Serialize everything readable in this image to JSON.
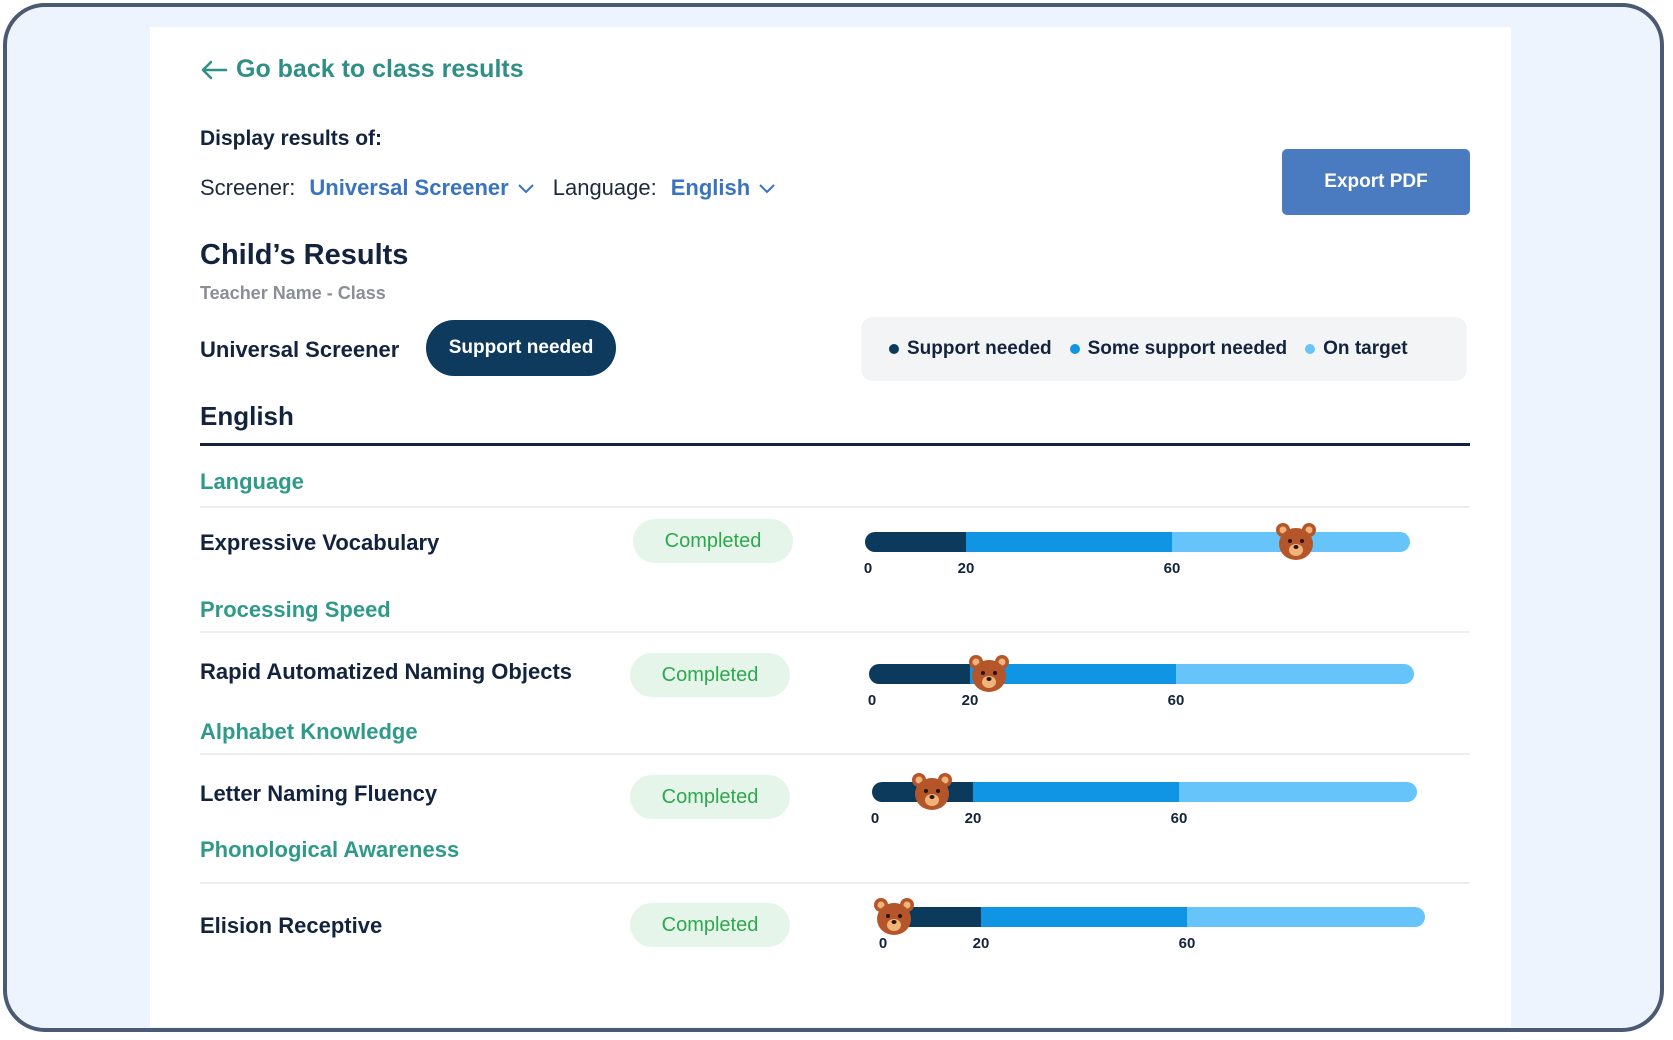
{
  "nav": {
    "back_label": "Go back to class results"
  },
  "filters": {
    "heading": "Display results of:",
    "screener_label": "Screener:",
    "screener_value": "Universal Screener",
    "language_label": "Language:",
    "language_value": "English"
  },
  "export_label": "Export PDF",
  "results": {
    "title": "Child’s Results",
    "subtitle": "Teacher Name - Class",
    "screener_name": "Universal Screener",
    "overall_status": "Support needed"
  },
  "legend": [
    {
      "label": "Support needed",
      "color": "#0b3a5c"
    },
    {
      "label": "Some support needed",
      "color": "#0f95e4"
    },
    {
      "label": "On target",
      "color": "#66c4fb"
    }
  ],
  "section_title": "English",
  "scale_ticks": [
    "0",
    "20",
    "60"
  ],
  "categories": [
    {
      "name": "Language",
      "test": "Expressive Vocabulary",
      "status": "Completed",
      "score_fraction": 0.79
    },
    {
      "name": "Processing Speed",
      "test": "Rapid Automatized Naming Objects",
      "status": "Completed",
      "score_fraction": 0.22
    },
    {
      "name": "Alphabet Knowledge",
      "test": "Letter Naming Fluency",
      "status": "Completed",
      "score_fraction": 0.11
    },
    {
      "name": "Phonological Awareness",
      "test": "Elision Receptive",
      "status": "Completed",
      "score_fraction": 0.0
    }
  ]
}
